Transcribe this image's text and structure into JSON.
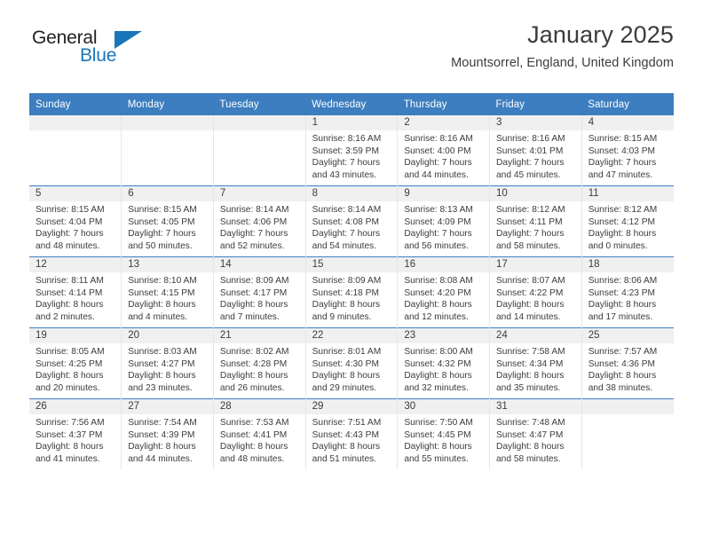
{
  "brand": {
    "name_top": "General",
    "name_bottom": "Blue",
    "triangle_icon": "blue-triangle-logo-mark",
    "color_dark": "#231f20",
    "color_blue": "#1b75bb"
  },
  "header": {
    "month_title": "January 2025",
    "location": "Mountsorrel, England, United Kingdom",
    "accent_color": "#3c7ebf"
  },
  "weekday_headers": [
    "Sunday",
    "Monday",
    "Tuesday",
    "Wednesday",
    "Thursday",
    "Friday",
    "Saturday"
  ],
  "calendar": {
    "weeks": [
      [
        {
          "day": "",
          "lines": []
        },
        {
          "day": "",
          "lines": []
        },
        {
          "day": "",
          "lines": []
        },
        {
          "day": "1",
          "lines": [
            "Sunrise: 8:16 AM",
            "Sunset: 3:59 PM",
            "Daylight: 7 hours",
            "and 43 minutes."
          ]
        },
        {
          "day": "2",
          "lines": [
            "Sunrise: 8:16 AM",
            "Sunset: 4:00 PM",
            "Daylight: 7 hours",
            "and 44 minutes."
          ]
        },
        {
          "day": "3",
          "lines": [
            "Sunrise: 8:16 AM",
            "Sunset: 4:01 PM",
            "Daylight: 7 hours",
            "and 45 minutes."
          ]
        },
        {
          "day": "4",
          "lines": [
            "Sunrise: 8:15 AM",
            "Sunset: 4:03 PM",
            "Daylight: 7 hours",
            "and 47 minutes."
          ]
        }
      ],
      [
        {
          "day": "5",
          "lines": [
            "Sunrise: 8:15 AM",
            "Sunset: 4:04 PM",
            "Daylight: 7 hours",
            "and 48 minutes."
          ]
        },
        {
          "day": "6",
          "lines": [
            "Sunrise: 8:15 AM",
            "Sunset: 4:05 PM",
            "Daylight: 7 hours",
            "and 50 minutes."
          ]
        },
        {
          "day": "7",
          "lines": [
            "Sunrise: 8:14 AM",
            "Sunset: 4:06 PM",
            "Daylight: 7 hours",
            "and 52 minutes."
          ]
        },
        {
          "day": "8",
          "lines": [
            "Sunrise: 8:14 AM",
            "Sunset: 4:08 PM",
            "Daylight: 7 hours",
            "and 54 minutes."
          ]
        },
        {
          "day": "9",
          "lines": [
            "Sunrise: 8:13 AM",
            "Sunset: 4:09 PM",
            "Daylight: 7 hours",
            "and 56 minutes."
          ]
        },
        {
          "day": "10",
          "lines": [
            "Sunrise: 8:12 AM",
            "Sunset: 4:11 PM",
            "Daylight: 7 hours",
            "and 58 minutes."
          ]
        },
        {
          "day": "11",
          "lines": [
            "Sunrise: 8:12 AM",
            "Sunset: 4:12 PM",
            "Daylight: 8 hours",
            "and 0 minutes."
          ]
        }
      ],
      [
        {
          "day": "12",
          "lines": [
            "Sunrise: 8:11 AM",
            "Sunset: 4:14 PM",
            "Daylight: 8 hours",
            "and 2 minutes."
          ]
        },
        {
          "day": "13",
          "lines": [
            "Sunrise: 8:10 AM",
            "Sunset: 4:15 PM",
            "Daylight: 8 hours",
            "and 4 minutes."
          ]
        },
        {
          "day": "14",
          "lines": [
            "Sunrise: 8:09 AM",
            "Sunset: 4:17 PM",
            "Daylight: 8 hours",
            "and 7 minutes."
          ]
        },
        {
          "day": "15",
          "lines": [
            "Sunrise: 8:09 AM",
            "Sunset: 4:18 PM",
            "Daylight: 8 hours",
            "and 9 minutes."
          ]
        },
        {
          "day": "16",
          "lines": [
            "Sunrise: 8:08 AM",
            "Sunset: 4:20 PM",
            "Daylight: 8 hours",
            "and 12 minutes."
          ]
        },
        {
          "day": "17",
          "lines": [
            "Sunrise: 8:07 AM",
            "Sunset: 4:22 PM",
            "Daylight: 8 hours",
            "and 14 minutes."
          ]
        },
        {
          "day": "18",
          "lines": [
            "Sunrise: 8:06 AM",
            "Sunset: 4:23 PM",
            "Daylight: 8 hours",
            "and 17 minutes."
          ]
        }
      ],
      [
        {
          "day": "19",
          "lines": [
            "Sunrise: 8:05 AM",
            "Sunset: 4:25 PM",
            "Daylight: 8 hours",
            "and 20 minutes."
          ]
        },
        {
          "day": "20",
          "lines": [
            "Sunrise: 8:03 AM",
            "Sunset: 4:27 PM",
            "Daylight: 8 hours",
            "and 23 minutes."
          ]
        },
        {
          "day": "21",
          "lines": [
            "Sunrise: 8:02 AM",
            "Sunset: 4:28 PM",
            "Daylight: 8 hours",
            "and 26 minutes."
          ]
        },
        {
          "day": "22",
          "lines": [
            "Sunrise: 8:01 AM",
            "Sunset: 4:30 PM",
            "Daylight: 8 hours",
            "and 29 minutes."
          ]
        },
        {
          "day": "23",
          "lines": [
            "Sunrise: 8:00 AM",
            "Sunset: 4:32 PM",
            "Daylight: 8 hours",
            "and 32 minutes."
          ]
        },
        {
          "day": "24",
          "lines": [
            "Sunrise: 7:58 AM",
            "Sunset: 4:34 PM",
            "Daylight: 8 hours",
            "and 35 minutes."
          ]
        },
        {
          "day": "25",
          "lines": [
            "Sunrise: 7:57 AM",
            "Sunset: 4:36 PM",
            "Daylight: 8 hours",
            "and 38 minutes."
          ]
        }
      ],
      [
        {
          "day": "26",
          "lines": [
            "Sunrise: 7:56 AM",
            "Sunset: 4:37 PM",
            "Daylight: 8 hours",
            "and 41 minutes."
          ]
        },
        {
          "day": "27",
          "lines": [
            "Sunrise: 7:54 AM",
            "Sunset: 4:39 PM",
            "Daylight: 8 hours",
            "and 44 minutes."
          ]
        },
        {
          "day": "28",
          "lines": [
            "Sunrise: 7:53 AM",
            "Sunset: 4:41 PM",
            "Daylight: 8 hours",
            "and 48 minutes."
          ]
        },
        {
          "day": "29",
          "lines": [
            "Sunrise: 7:51 AM",
            "Sunset: 4:43 PM",
            "Daylight: 8 hours",
            "and 51 minutes."
          ]
        },
        {
          "day": "30",
          "lines": [
            "Sunrise: 7:50 AM",
            "Sunset: 4:45 PM",
            "Daylight: 8 hours",
            "and 55 minutes."
          ]
        },
        {
          "day": "31",
          "lines": [
            "Sunrise: 7:48 AM",
            "Sunset: 4:47 PM",
            "Daylight: 8 hours",
            "and 58 minutes."
          ]
        },
        {
          "day": "",
          "lines": []
        }
      ]
    ]
  }
}
